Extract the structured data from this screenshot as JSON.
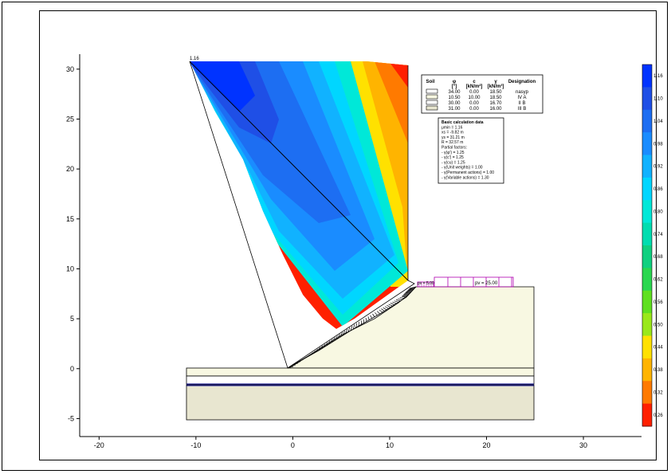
{
  "chart_data": {
    "type": "heatmap",
    "x_ticks": [
      -20,
      -10,
      0,
      10,
      20,
      30
    ],
    "y_ticks": [
      30,
      25,
      20,
      15,
      10,
      5,
      0,
      -5
    ],
    "xlim": [
      -22,
      36
    ],
    "ylim": [
      -6.8,
      31.5
    ],
    "top_label": "1.16",
    "colorbar": {
      "labels": [
        "1.16",
        "1.10",
        "1.04",
        "0.98",
        "0.92",
        "0.86",
        "0.80",
        "0.74",
        "0.68",
        "0.62",
        "0.56",
        "0.50",
        "0.44",
        "0.38",
        "0.32",
        "0.26"
      ],
      "colors": [
        "#0033ff",
        "#1f4fe6",
        "#1d6ef2",
        "#1a8cff",
        "#11b2ff",
        "#00d6ff",
        "#00e8d8",
        "#00ddb0",
        "#10d080",
        "#2ad750",
        "#60e020",
        "#9ae81a",
        "#ffe100",
        "#ffb400",
        "#ff7a00",
        "#ff2000"
      ]
    },
    "soil_table": {
      "headers": [
        "Soil",
        "φ_ef [°]",
        "c_ef [kN/m²]",
        "γ_s [kN/m³]",
        "Designation"
      ],
      "header_lines": [
        [
          "Soil"
        ],
        [
          "φ",
          "[°]"
        ],
        [
          "c",
          "[kN/m²]"
        ],
        [
          "γ",
          "[kN/m³]"
        ],
        [
          "Designation"
        ]
      ],
      "rows": [
        {
          "phi": "34.00",
          "c": "0.00",
          "gamma": "18.50",
          "name": "nasyp",
          "fill": "#ffffff"
        },
        {
          "phi": "10.50",
          "c": "10.00",
          "gamma": "18.50",
          "name": "IV A",
          "fill": "#f8f8e2"
        },
        {
          "phi": "30.00",
          "c": "0.00",
          "gamma": "16.70",
          "name": "II B",
          "fill": "#ffffff"
        },
        {
          "phi": "31.00",
          "c": "0.00",
          "gamma": "16.00",
          "name": "III B",
          "fill": "#e8e6d0"
        }
      ]
    },
    "calc_box": {
      "lines": [
        "Basic calculation data",
        "μmin = 1.16",
        "xs = -9.82 m",
        "ys = 31.21 m",
        "R = 32.57 m",
        "Partial factors:",
        " - γ(φ') = 1.25",
        " - γ(c') = 1.25",
        " - γ(cu) = 1.25",
        " - γ(Unit weights) = 1.00",
        " - γ(Permanent actions) = 1.00",
        " - γ(Variable actions) = 1.30"
      ]
    },
    "loads": [
      {
        "label": "pv = 5.00"
      },
      {
        "label": "pv = 25.00"
      }
    ]
  }
}
